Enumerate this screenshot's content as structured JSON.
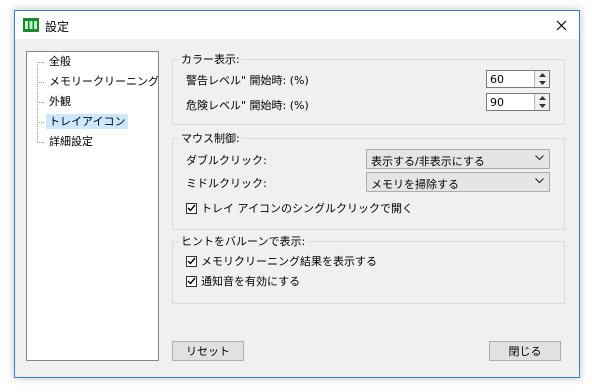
{
  "window": {
    "title": "設定"
  },
  "tree": {
    "items": [
      {
        "label": "全般"
      },
      {
        "label": "メモリークリーニング"
      },
      {
        "label": "外観"
      },
      {
        "label": "トレイアイコン",
        "selected": true
      },
      {
        "label": "詳細設定"
      }
    ]
  },
  "color_display": {
    "legend": "カラー表示:",
    "warning_label": "警告レベル\" 開始時: (%)",
    "warning_value": "60",
    "danger_label": "危険レベル\" 開始時: (%)",
    "danger_value": "90"
  },
  "mouse": {
    "legend": "マウス制御:",
    "double_click_label": "ダブルクリック:",
    "double_click_value": "表示する/非表示にする",
    "middle_click_label": "ミドルクリック:",
    "middle_click_value": "メモリを掃除する",
    "single_click_open_label": "トレイ アイコンのシングルクリックで開く",
    "single_click_open_checked": true
  },
  "balloon": {
    "legend": "ヒントをバルーンで表示:",
    "show_result_label": "メモリクリーニング結果を表示する",
    "show_result_checked": true,
    "notify_sound_label": "通知音を有効にする",
    "notify_sound_checked": true
  },
  "buttons": {
    "reset": "リセット",
    "close": "閉じる"
  },
  "icons": {
    "app": "app-icon",
    "close": "close-icon",
    "spin_up": "spin-up-icon",
    "spin_down": "spin-down-icon",
    "chevron": "chevron-down-icon",
    "check": "check-icon"
  },
  "colors": {
    "accent_border": "#3c7ad6",
    "selection": "#cce8ff",
    "app_icon": "#1a8a2e"
  }
}
